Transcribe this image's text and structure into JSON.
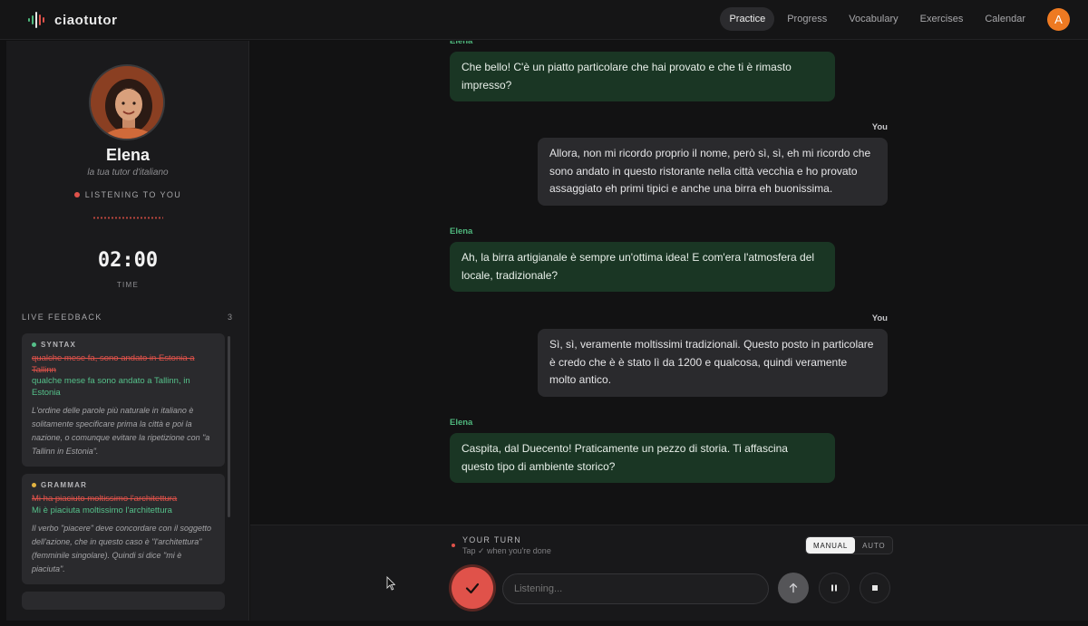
{
  "app": {
    "name": "ciaotutor"
  },
  "nav": {
    "items": [
      "Practice",
      "Progress",
      "Vocabulary",
      "Exercises",
      "Calendar"
    ],
    "active": "Practice",
    "avatar_initial": "A"
  },
  "tutor": {
    "name": "Elena",
    "subtitle": "la tua tutor d'italiano",
    "status": "LISTENING TO YOU",
    "timer": "02:00",
    "timer_label": "TIME"
  },
  "feedback": {
    "header": "LIVE FEEDBACK",
    "count": "3",
    "items": [
      {
        "tag": "SYNTAX",
        "color": "#55c08a",
        "wrong": "qualche mese fa, sono andato in Estonia a Tallinn",
        "right": "qualche mese fa sono andato a Tallinn, in Estonia",
        "explanation": "L'ordine delle parole più naturale in italiano è solitamente specificare prima la città e poi la nazione, o comunque evitare la ripetizione con \"a Tallinn in Estonia\"."
      },
      {
        "tag": "GRAMMAR",
        "color": "#e3b341",
        "wrong": "Mi ha piaciuto moltissimo l'architettura",
        "right": "Mi è piaciuta moltissimo l'architettura",
        "explanation": "Il verbo \"piacere\" deve concordare con il soggetto dell'azione, che in questo caso è \"l'architettura\" (femminile singolare). Quindi si dice \"mi è piaciuta\"."
      }
    ]
  },
  "chat": {
    "tutor_name": "Elena",
    "user_name": "You",
    "messages": [
      {
        "from": "tutor",
        "text": "Che bello! C'è un piatto particolare che hai provato e che ti è rimasto impresso?"
      },
      {
        "from": "user",
        "text": "Allora, non mi ricordo proprio il nome, però sì, sì, eh mi ricordo che sono andato in questo ristorante nella città vecchia e ho provato assaggiato eh primi tipici e anche una birra eh buonissima."
      },
      {
        "from": "tutor",
        "text": "Ah, la birra artigianale è sempre un'ottima idea! E com'era l'atmosfera del locale, tradizionale?"
      },
      {
        "from": "user",
        "text": "Sì, sì, veramente moltissimi tradizionali. Questo posto in particolare è credo che è è stato lì da 1200 e qualcosa, quindi veramente molto antico."
      },
      {
        "from": "tutor",
        "text": "Caspita, dal Duecento! Praticamente un pezzo di storia. Ti affascina questo tipo di ambiente storico?"
      }
    ]
  },
  "composer": {
    "turn_title": "YOUR TURN",
    "turn_hint": "Tap ✓ when you're done",
    "mode_manual": "MANUAL",
    "mode_auto": "AUTO",
    "mode_selected": "MANUAL",
    "input_placeholder": "Listening..."
  },
  "colors": {
    "accent_red": "#e0524a",
    "tutor_green": "#4fb77d",
    "tutor_bubble": "#1a3624",
    "user_bubble": "#2a2a2d",
    "avatar_orange": "#ee7a22"
  }
}
